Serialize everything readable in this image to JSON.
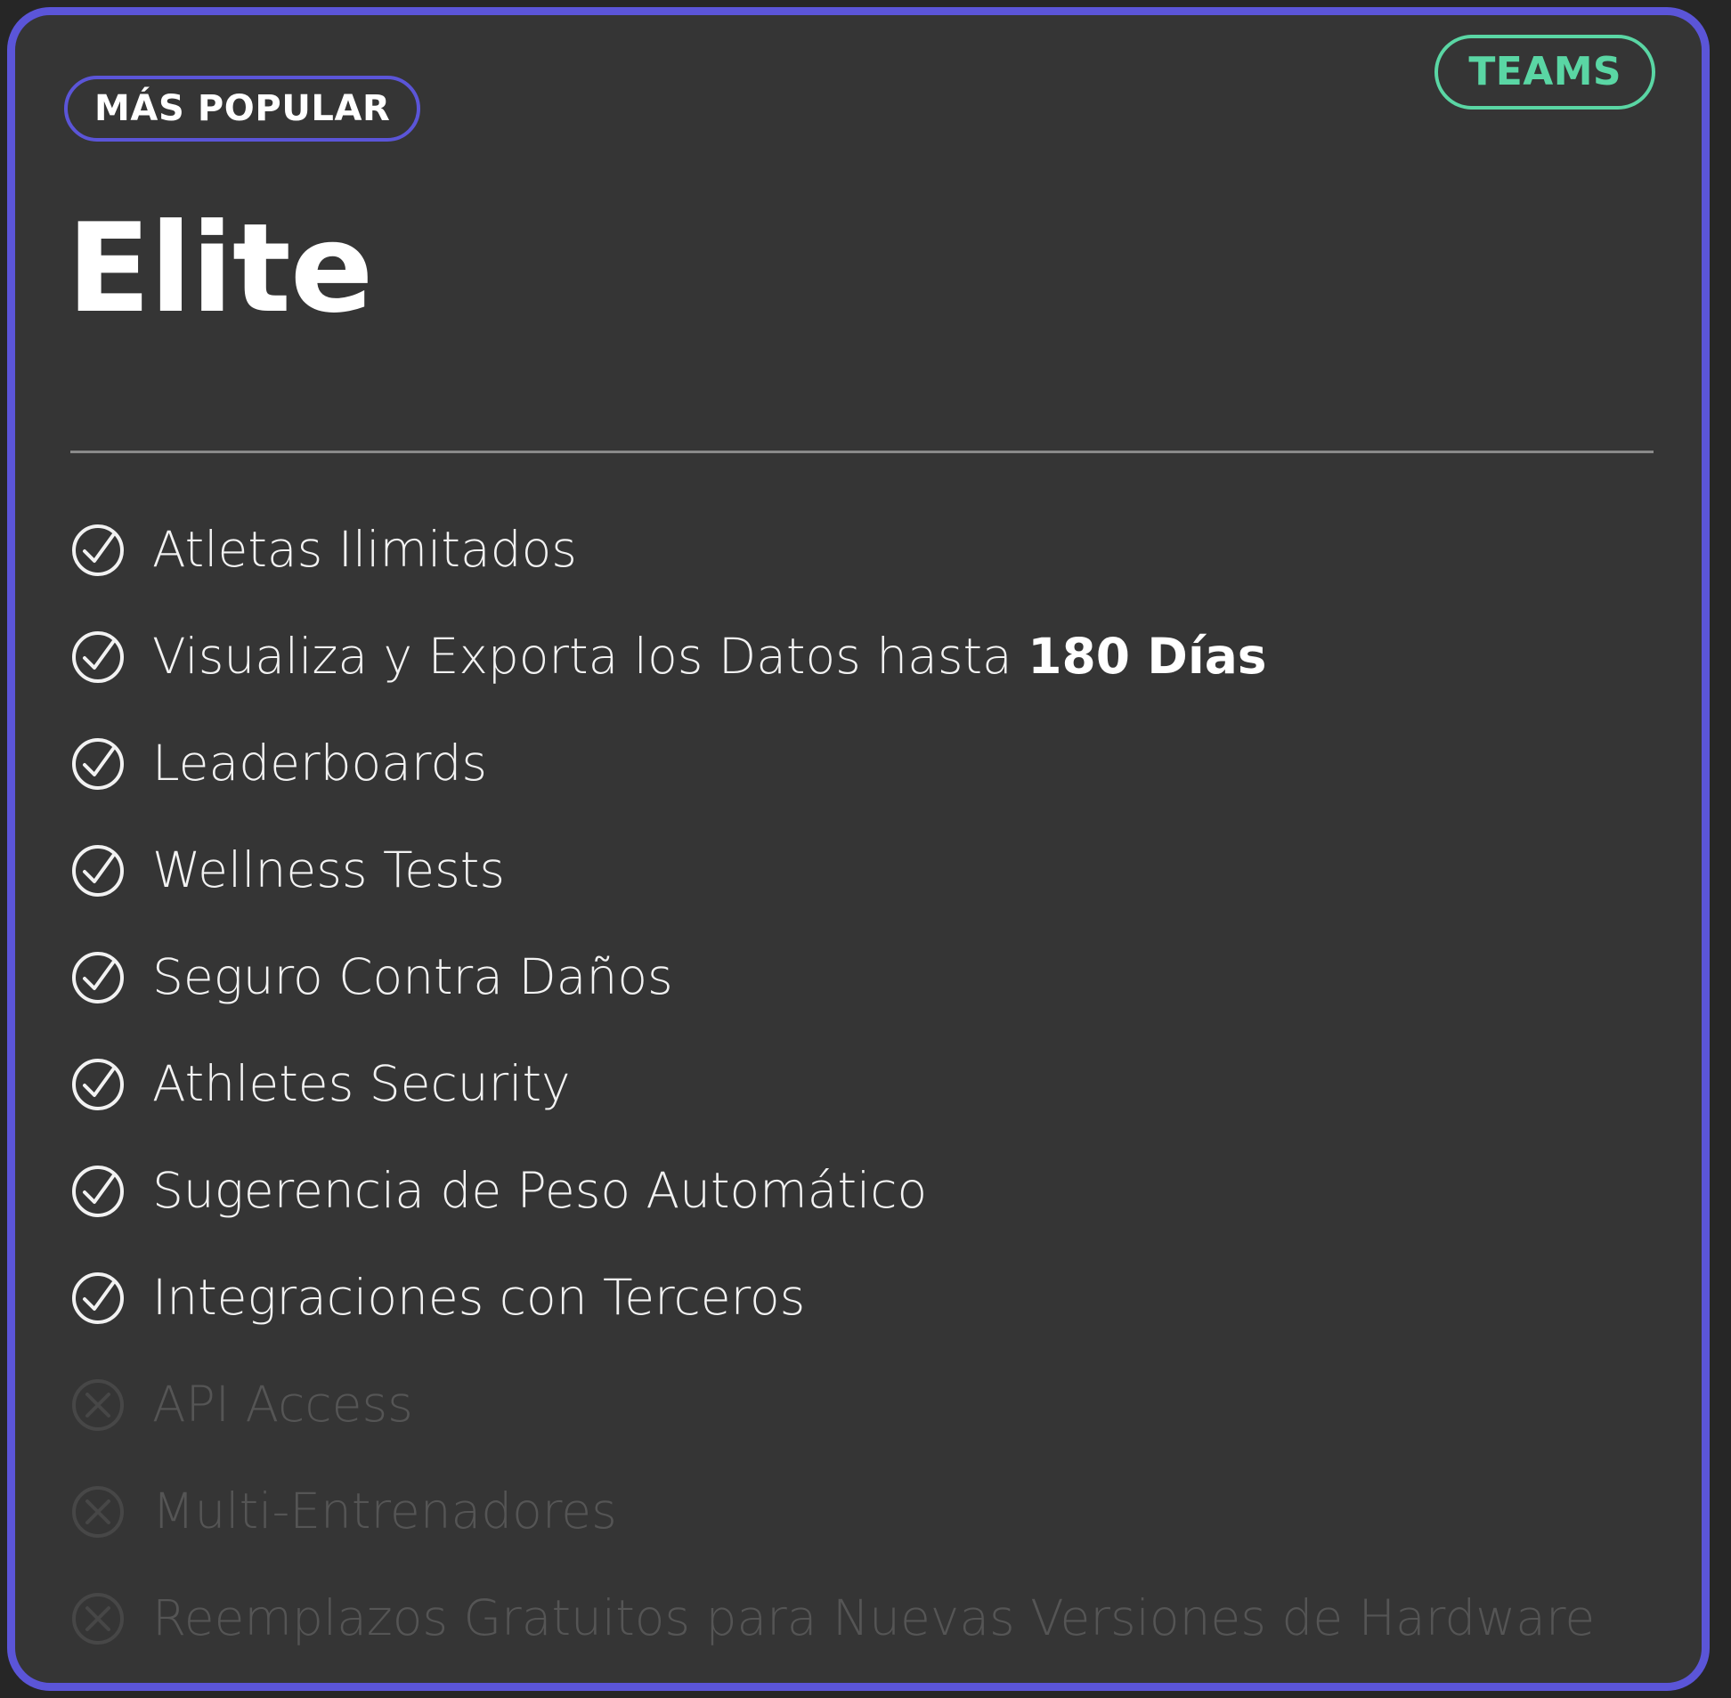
{
  "card": {
    "plan_name": "Elite",
    "badge_popular": "MÁS POPULAR",
    "badge_tier": "TEAMS",
    "accent_purple": "#5b55d8",
    "accent_teal": "#5ad6a4",
    "card_background": "#353535",
    "page_background": "#262626",
    "divider_color": "#8a8a8a",
    "enabled_text_color": "#f2f2f2",
    "disabled_text_color": "#555555"
  },
  "features": [
    {
      "label": "Atletas Ilimitados",
      "emphasis": "",
      "included": true,
      "icon": "check-circle-icon"
    },
    {
      "label": "Visualiza y Exporta los Datos hasta ",
      "emphasis": "180 Días",
      "included": true,
      "icon": "check-circle-icon"
    },
    {
      "label": "Leaderboards",
      "emphasis": "",
      "included": true,
      "icon": "check-circle-icon"
    },
    {
      "label": "Wellness Tests",
      "emphasis": "",
      "included": true,
      "icon": "check-circle-icon"
    },
    {
      "label": "Seguro Contra Daños",
      "emphasis": "",
      "included": true,
      "icon": "check-circle-icon"
    },
    {
      "label": "Athletes Security",
      "emphasis": "",
      "included": true,
      "icon": "check-circle-icon"
    },
    {
      "label": "Sugerencia de Peso Automático",
      "emphasis": "",
      "included": true,
      "icon": "check-circle-icon"
    },
    {
      "label": "Integraciones con Terceros",
      "emphasis": "",
      "included": true,
      "icon": "check-circle-icon"
    },
    {
      "label": "API Access",
      "emphasis": "",
      "included": false,
      "icon": "x-circle-icon"
    },
    {
      "label": "Multi-Entrenadores",
      "emphasis": "",
      "included": false,
      "icon": "x-circle-icon"
    },
    {
      "label": "Reemplazos Gratuitos para Nuevas Versiones de Hardware",
      "emphasis": "",
      "included": false,
      "icon": "x-circle-icon"
    }
  ]
}
